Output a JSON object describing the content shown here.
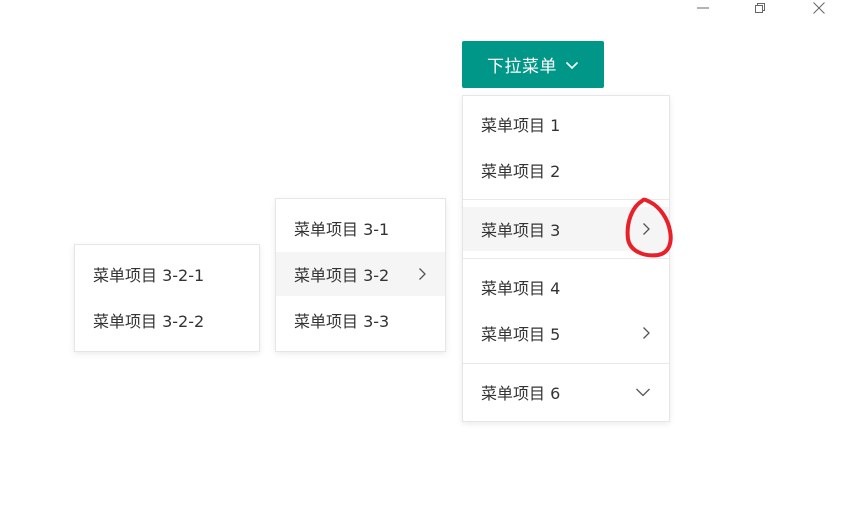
{
  "window": {
    "minimize_icon": "minimize-icon",
    "restore_icon": "restore-icon",
    "close_icon": "close-icon"
  },
  "trigger": {
    "label": "下拉菜单",
    "icon": "chevron-down-icon",
    "color": "#009688"
  },
  "menu": {
    "items": [
      {
        "label": "菜单项目 1"
      },
      {
        "label": "菜单项目 2"
      },
      {
        "label": "菜单项目 3",
        "icon": "chevron-right-icon",
        "state": "hover"
      },
      {
        "label": "菜单项目 4"
      },
      {
        "label": "菜单项目 5",
        "icon": "chevron-right-icon"
      },
      {
        "label": "菜单项目 6",
        "icon": "chevron-down-icon"
      }
    ]
  },
  "submenu": {
    "items": [
      {
        "label": "菜单项目 3-1"
      },
      {
        "label": "菜单项目 3-2",
        "icon": "chevron-right-icon",
        "state": "hover"
      },
      {
        "label": "菜单项目 3-3"
      }
    ]
  },
  "subsubmenu": {
    "items": [
      {
        "label": "菜单项目 3-2-1"
      },
      {
        "label": "菜单项目 3-2-2"
      }
    ]
  },
  "annotation": {
    "color": "#e8202a",
    "shape": "hand-drawn-circle"
  }
}
